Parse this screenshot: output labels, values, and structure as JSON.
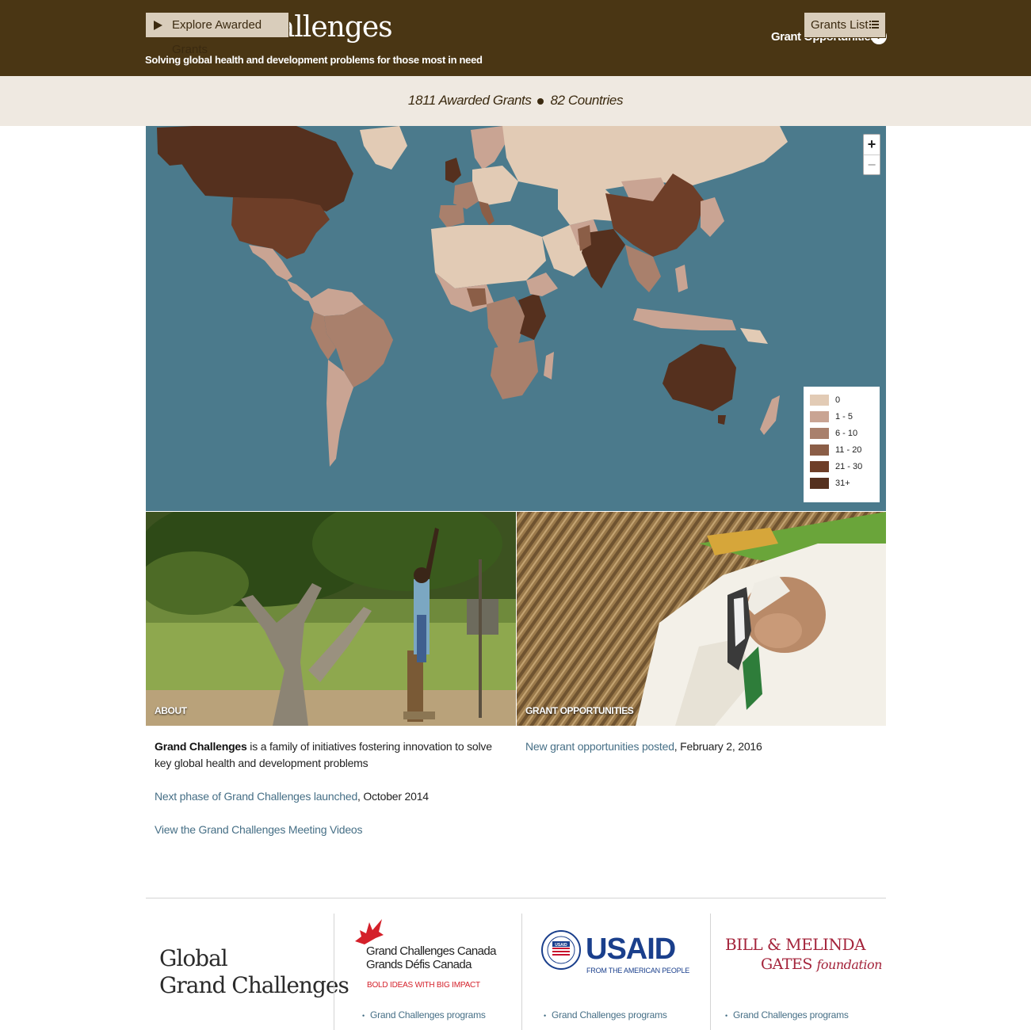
{
  "header": {
    "title": "Grand Challenges",
    "tagline": "Solving global health and development problems for those most in need",
    "opportunities_link": "Grant Opportunities"
  },
  "subbar": {
    "explore_label": "Explore Awarded Grants",
    "awarded_grants": "1811 Awarded Grants",
    "countries": "82 Countries",
    "grants_list_label": "Grants List"
  },
  "map": {
    "zoom_in": "+",
    "zoom_out": "−",
    "legend": [
      {
        "label": "0",
        "color": "#e2cbb5"
      },
      {
        "label": "1 - 5",
        "color": "#c9a493"
      },
      {
        "label": "6 - 10",
        "color": "#a9806c"
      },
      {
        "label": "11 - 20",
        "color": "#8b5e47"
      },
      {
        "label": "21 - 30",
        "color": "#6e3e28"
      },
      {
        "label": "31+",
        "color": "#55301e"
      }
    ]
  },
  "photos": {
    "about_label": "ABOUT",
    "opps_label": "GRANT OPPORTUNITIES"
  },
  "about": {
    "intro_bold": "Grand Challenges",
    "intro_rest": " is a family of initiatives fostering innovation to solve key global health and development problems",
    "news_link": "Next phase of Grand Challenges launched",
    "news_date": ", October 2014",
    "videos_link": "View the Grand Challenges Meeting Videos"
  },
  "opportunities": {
    "link": "New grant opportunities posted",
    "date": ", February 2, 2016"
  },
  "footer": {
    "global_line1": "Global",
    "global_line2": "Grand Challenges",
    "gcc_line1": "Grand Challenges Canada",
    "gcc_line2": "Grands Défis Canada",
    "gcc_tagline": "BOLD IDEAS WITH BIG IMPACT",
    "usaid_word": "USAID",
    "usaid_sub": "FROM THE AMERICAN PEOPLE",
    "usaid_seal_text": "USAID",
    "gates_line1": "BILL & MELINDA",
    "gates_line2": "GATES",
    "gates_line2b": "foundation",
    "programs_link": "Grand Challenges programs"
  }
}
